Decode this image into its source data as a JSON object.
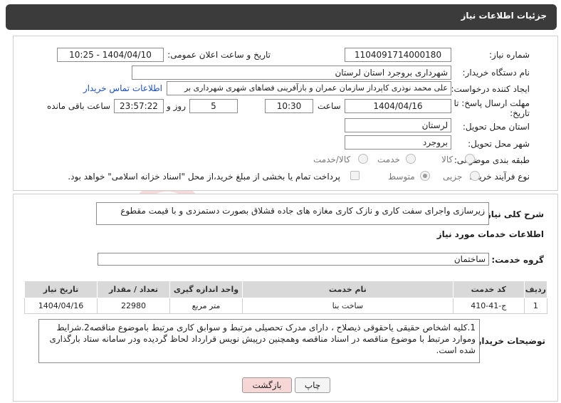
{
  "header": {
    "title": "جزئیات اطلاعات نیاز"
  },
  "fields": {
    "need_number_label": "شماره نیاز:",
    "need_number": "1104091714000180",
    "announce_label": "تاریخ و ساعت اعلان عمومی:",
    "announce_value": "1404/04/10 - 10:25",
    "buyer_org_label": "نام دستگاه خریدار:",
    "buyer_org": "شهرداری بروجرد استان لرستان",
    "requester_label": "ایجاد کننده درخواست:",
    "requester": "علی محمد نوذری کاپرداز سازمان عمران و بازآفرینی فضاهای شهری شهرداری بر",
    "contact_link": "اطلاعات تماس خریدار",
    "deadline_label_1": "مهلت ارسال پاسخ: تا",
    "deadline_label_2": "تاریخ:",
    "deadline_date": "1404/04/16",
    "time_label": "ساعت",
    "deadline_time": "10:30",
    "days_value": "5",
    "days_label": "روز و",
    "remaining_time": "23:57:22",
    "remaining_label": "ساعت باقی مانده",
    "province_label": "استان محل تحویل:",
    "province": "لرستان",
    "city_label": "شهر محل تحویل:",
    "city": "بروجرد",
    "category_label": "طبقه بندی موضوعی:",
    "category_options": [
      "کالا",
      "خدمت",
      "کالا/خدمت"
    ],
    "process_label": "نوع فرآیند خرید :",
    "process_options": [
      "جزیی",
      "متوسط"
    ],
    "payment_note": "پرداخت تمام یا بخشی از مبلغ خرید،از محل \"اسناد خزانه اسلامی\" خواهد بود."
  },
  "summary": {
    "label": "شرح کلی نیاز:",
    "text": "زیرسازی واجرای سفت کاری و نازک کاری مغازه های جاده قشلاق بصورت دستمزدی و با قیمت مقطوع"
  },
  "services": {
    "section_title": "اطلاعات خدمات مورد نیاز",
    "group_label": "گروه خدمت:",
    "group_value": "ساختمان",
    "columns": [
      "ردیف",
      "کد خدمت",
      "نام خدمت",
      "واحد اندازه گیری",
      "تعداد / مقدار",
      "تاریخ نیاز"
    ],
    "rows": [
      {
        "row": "1",
        "code": "ج-41-410",
        "name": "ساخت بنا",
        "unit": "متر مربع",
        "qty": "22980",
        "date": "1404/04/16"
      }
    ]
  },
  "buyer_notes": {
    "label": "توضیحات خریدار:",
    "text": "1.کلیه اشخاص حقیقی یاحقوقی ذیصلاح ، دارای مدرک تحصیلی مرتبط و سوابق کاری مرتبط باموضوع مناقصه2.شرایط وموارد مرتبط با موضوع مناقصه در اسناد مناقصه وهمچنین درپیش نویس قرارداد لحاظ گردیده ودر سامانه ستاد بارگذاری شده است."
  },
  "buttons": {
    "print": "چاپ",
    "back": "بازگشت"
  },
  "watermark": "AriaTender.neT",
  "colors": {
    "header_bg": "#3b3b3b",
    "link": "#1d4fb8",
    "back_button_bg": "#f7d6d6"
  }
}
